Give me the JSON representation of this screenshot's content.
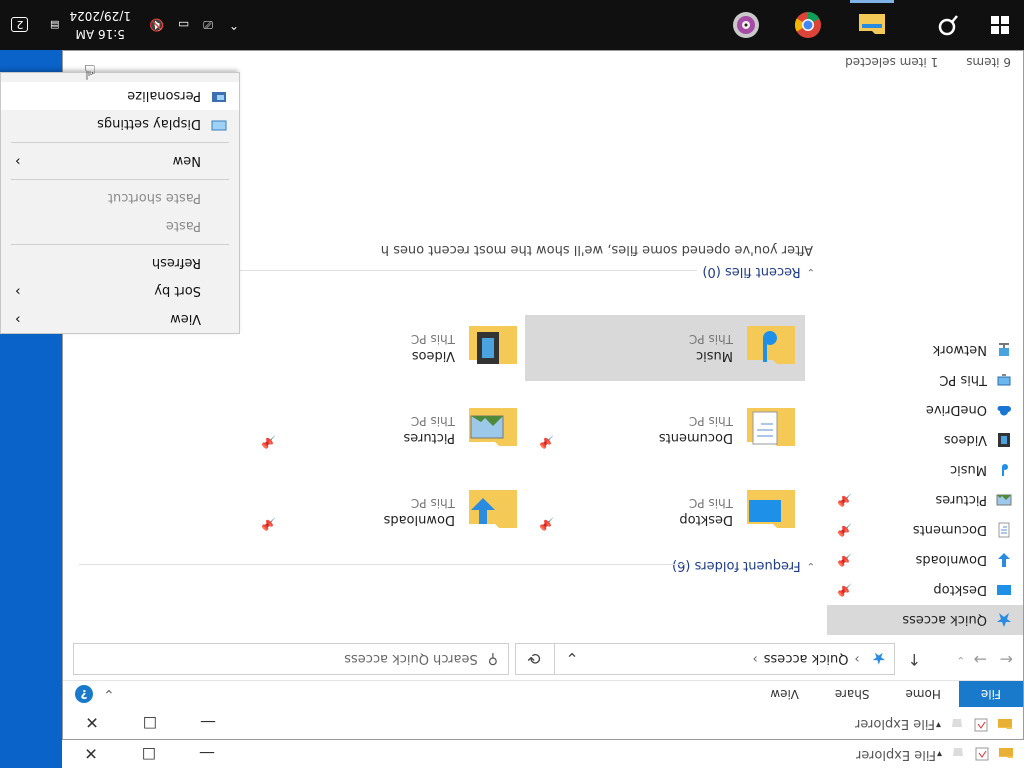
{
  "window": {
    "title": "File Explorer",
    "buttons": {
      "minimize": "—",
      "maximize": "☐",
      "close": "✕"
    }
  },
  "back_window": {
    "title": "File Explorer"
  },
  "ribbon": {
    "tabs": [
      {
        "label": "File"
      },
      {
        "label": "Home"
      },
      {
        "label": "Share"
      },
      {
        "label": "View"
      }
    ],
    "help": "?",
    "collapse_glyph": "⌄"
  },
  "address": {
    "path": "Quick access",
    "search_placeholder": "Search Quick access"
  },
  "navigation": {
    "items": [
      {
        "label": "Quick access",
        "icon": "star-icon",
        "pinned": false,
        "selected": true
      },
      {
        "label": "Desktop",
        "icon": "desktop-icon",
        "pinned": true
      },
      {
        "label": "Downloads",
        "icon": "download-icon",
        "pinned": true
      },
      {
        "label": "Documents",
        "icon": "document-icon",
        "pinned": true
      },
      {
        "label": "Pictures",
        "icon": "picture-icon",
        "pinned": true
      },
      {
        "label": "Music",
        "icon": "music-icon",
        "pinned": false
      },
      {
        "label": "Videos",
        "icon": "video-icon",
        "pinned": false
      },
      {
        "label": "OneDrive",
        "icon": "cloud-icon",
        "pinned": false
      },
      {
        "label": "This PC",
        "icon": "computer-icon",
        "pinned": false
      },
      {
        "label": "Network",
        "icon": "network-icon",
        "pinned": false
      }
    ]
  },
  "frequent": {
    "header": "Frequent folders (6)",
    "folders": [
      {
        "name": "Desktop",
        "location": "This PC",
        "icon": "desktop-folder-icon",
        "pinned": true
      },
      {
        "name": "Downloads",
        "location": "This PC",
        "icon": "downloads-folder-icon",
        "pinned": true
      },
      {
        "name": "Documents",
        "location": "This PC",
        "icon": "documents-folder-icon",
        "pinned": true
      },
      {
        "name": "Pictures",
        "location": "This PC",
        "icon": "pictures-folder-icon",
        "pinned": true
      },
      {
        "name": "Music",
        "location": "This PC",
        "icon": "music-folder-icon",
        "pinned": false,
        "selected": true
      },
      {
        "name": "Videos",
        "location": "This PC",
        "icon": "videos-folder-icon",
        "pinned": false
      }
    ]
  },
  "recent": {
    "header": "Recent files (0)",
    "message": "After you've opened some files, we'll show the most recent ones h"
  },
  "status": {
    "items": "6 items",
    "selected": "1 item selected"
  },
  "context_menu": {
    "items": [
      {
        "label": "View",
        "submenu": true,
        "disabled": false
      },
      {
        "label": "Sort by",
        "submenu": true,
        "disabled": false
      },
      {
        "label": "Refresh",
        "submenu": false,
        "disabled": false
      },
      {
        "sep": true
      },
      {
        "label": "Paste",
        "submenu": false,
        "disabled": true
      },
      {
        "label": "Paste shortcut",
        "submenu": false,
        "disabled": true
      },
      {
        "sep": true
      },
      {
        "label": "New",
        "submenu": true,
        "disabled": false
      },
      {
        "sep": true
      },
      {
        "label": "Display settings",
        "icon": "display-icon",
        "submenu": false,
        "disabled": false
      },
      {
        "label": "Personalize",
        "icon": "personalize-icon",
        "submenu": false,
        "disabled": false,
        "highlighted": true
      }
    ]
  },
  "taskbar": {
    "apps": [
      {
        "name": "search-icon",
        "active": false
      },
      {
        "name": "file-explorer-icon",
        "active": true
      },
      {
        "name": "chrome-icon",
        "active": false
      },
      {
        "name": "dvd-player-icon",
        "active": false
      }
    ],
    "time": "5:16 AM",
    "date": "1/29/2024",
    "notification_count": "2"
  },
  "colors": {
    "accent": "#1979ca",
    "taskbar": "#101010",
    "desktop": "#0a63c9",
    "selection": "#d9d9d9"
  }
}
